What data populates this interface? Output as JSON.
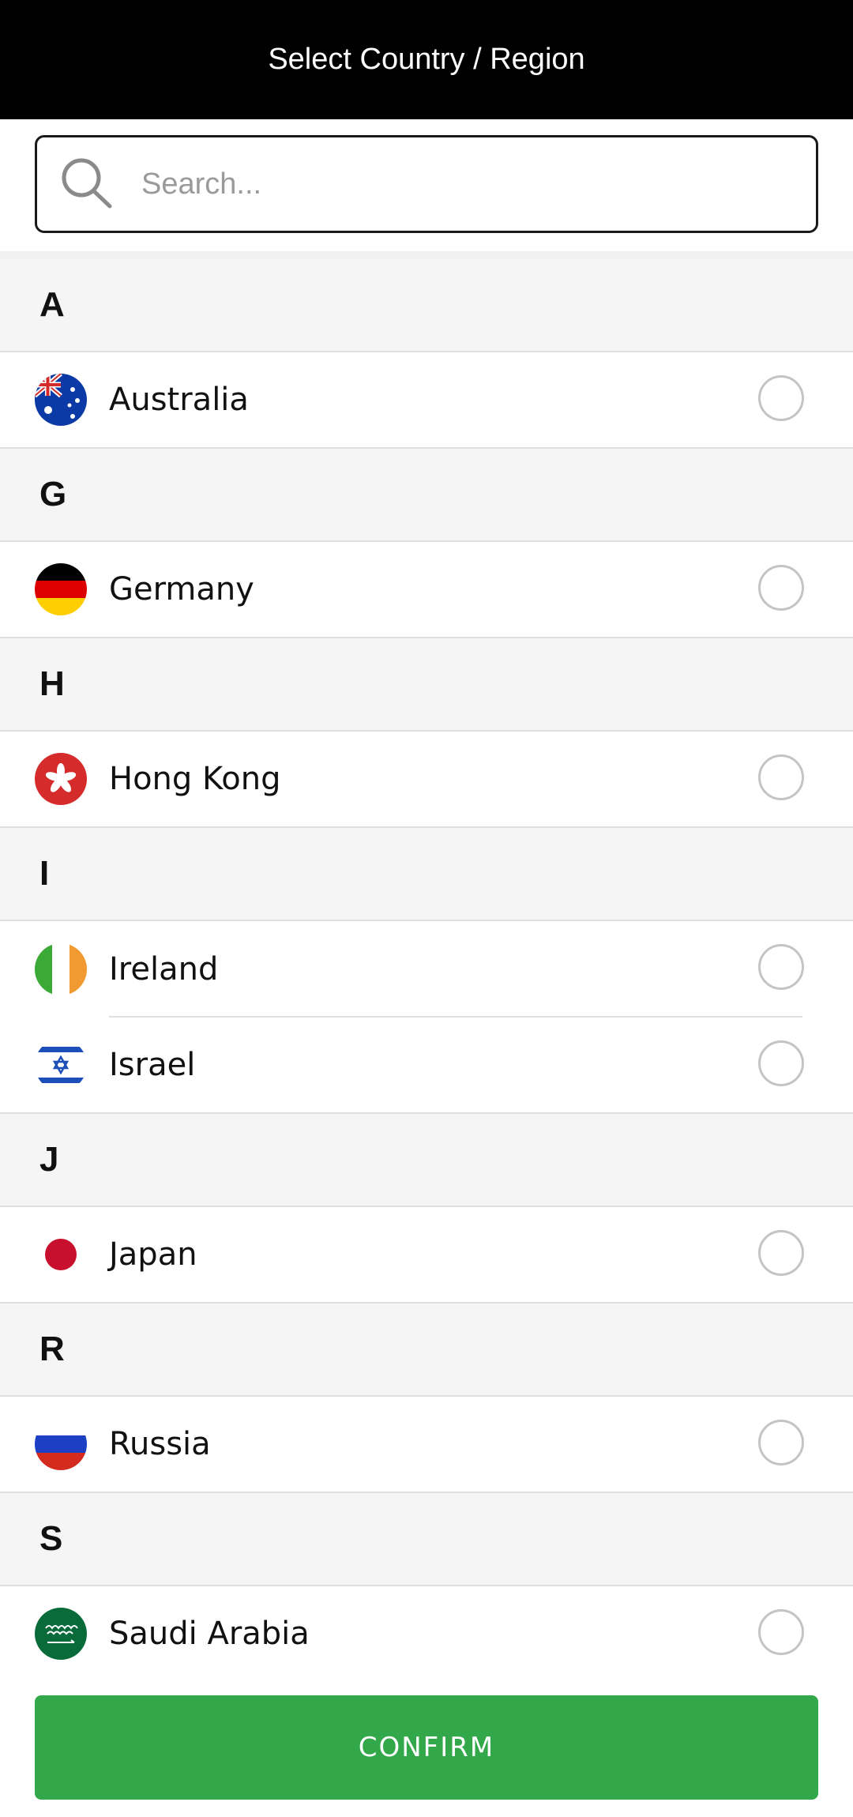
{
  "header": {
    "title": "Select Country / Region"
  },
  "search": {
    "placeholder": "Search...",
    "value": ""
  },
  "sections": [
    {
      "letter": "A",
      "countries": [
        {
          "name": "Australia",
          "flag": "australia-flag-icon",
          "selected": false
        }
      ]
    },
    {
      "letter": "G",
      "countries": [
        {
          "name": "Germany",
          "flag": "germany-flag-icon",
          "selected": false
        }
      ]
    },
    {
      "letter": "H",
      "countries": [
        {
          "name": "Hong Kong",
          "flag": "hong-kong-flag-icon",
          "selected": false
        }
      ]
    },
    {
      "letter": "I",
      "countries": [
        {
          "name": "Ireland",
          "flag": "ireland-flag-icon",
          "selected": false
        },
        {
          "name": "Israel",
          "flag": "israel-flag-icon",
          "selected": false
        }
      ]
    },
    {
      "letter": "J",
      "countries": [
        {
          "name": "Japan",
          "flag": "japan-flag-icon",
          "selected": false
        }
      ]
    },
    {
      "letter": "R",
      "countries": [
        {
          "name": "Russia",
          "flag": "russia-flag-icon",
          "selected": false
        }
      ]
    },
    {
      "letter": "S",
      "countries": [
        {
          "name": "Saudi Arabia",
          "flag": "saudi-arabia-flag-icon",
          "selected": false
        }
      ]
    }
  ],
  "footer": {
    "confirm_label": "CONFIRM"
  },
  "colors": {
    "header_bg": "#000000",
    "confirm_bg": "#33a84a",
    "section_bg": "#f5f5f5",
    "radio_border": "#c4c4c4"
  }
}
